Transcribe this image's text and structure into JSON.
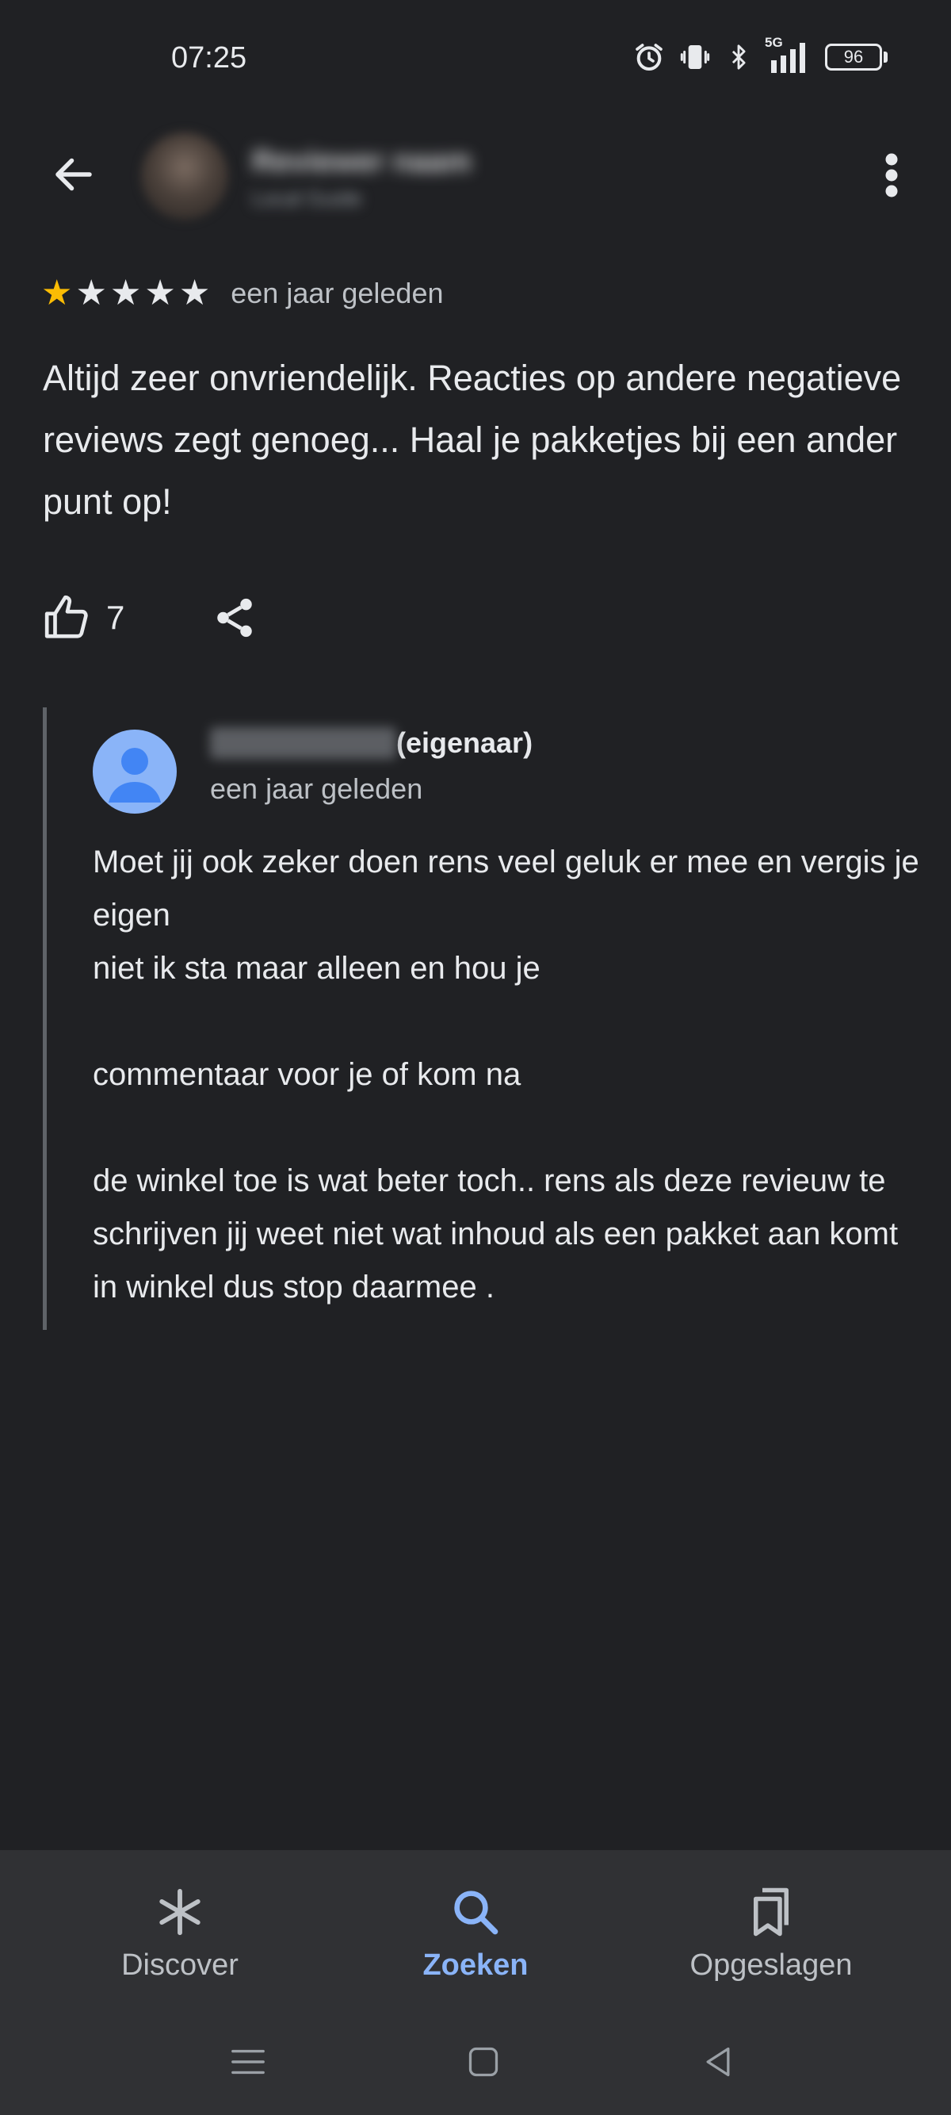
{
  "status_bar": {
    "time": "07:25",
    "network": "5G",
    "battery": "96",
    "icons": [
      "alarm-icon",
      "vibrate-icon",
      "bluetooth-icon",
      "signal-icon",
      "battery-icon"
    ]
  },
  "header": {
    "back_icon": "arrow-back-icon",
    "author_name": "Reviewer naam",
    "author_sub": "Local Guide",
    "more_icon": "more-vert-icon"
  },
  "review": {
    "rating": 1,
    "max_rating": 5,
    "time": "een jaar geleden",
    "text": "Altijd zeer onvriendelijk. Reacties op andere negatieve reviews zegt genoeg... Haal je pakketjes bij een ander punt op!",
    "likes": "7",
    "like_icon": "thumb-up-icon",
    "share_icon": "share-icon"
  },
  "reply": {
    "owner_label": "(eigenaar)",
    "time": "een jaar geleden",
    "text": "Moet jij ook zeker doen rens veel geluk er mee en vergis je eigen\nniet ik sta maar alleen en hou je\n\ncommentaar voor je of kom na\n\nde winkel toe is wat beter toch.. rens als deze revieuw te schrijven jij weet niet wat inhoud als een pakket aan komt in winkel dus stop daarmee ."
  },
  "bottom_nav": {
    "items": [
      {
        "label": "Discover",
        "icon": "asterisk-icon",
        "active": false
      },
      {
        "label": "Zoeken",
        "icon": "search-icon",
        "active": true
      },
      {
        "label": "Opgeslagen",
        "icon": "bookmarks-icon",
        "active": false
      }
    ]
  },
  "colors": {
    "background": "#202124",
    "nav_background": "#303134",
    "accent": "#8ab4f8",
    "star": "#fbbc04",
    "text": "#e8eaed",
    "muted": "#bdc1c6"
  }
}
